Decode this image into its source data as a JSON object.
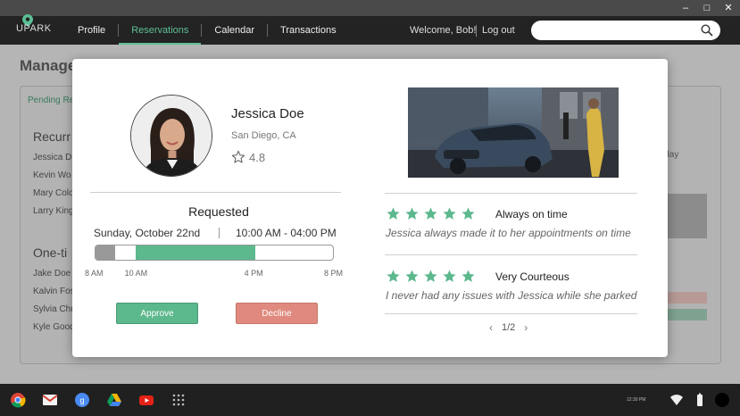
{
  "window": {
    "minimize": "–",
    "maximize": "□",
    "close": "✕"
  },
  "nav": {
    "logo": "UPARK",
    "tabs": [
      {
        "label": "Profile"
      },
      {
        "label": "Reservations"
      },
      {
        "label": "Calendar"
      },
      {
        "label": "Transactions"
      }
    ],
    "active_tab": "Reservations",
    "welcome": "Welcome, Bob!",
    "logout": "Log out",
    "search_placeholder": ""
  },
  "background_page": {
    "title": "Manage",
    "tab": "Pending Re",
    "section_recurring": "Recurr",
    "recurring_names": [
      "Jessica D",
      "Kevin Wo",
      "Mary Colo",
      "Larry King"
    ],
    "section_onetime": "One-ti",
    "onetime_names": [
      "Jake Doe",
      "Kalvin Fos",
      "Sylvia Chu",
      "Kyle Good"
    ],
    "day_label": "aturday"
  },
  "modal": {
    "profile": {
      "name": "Jessica Doe",
      "location": "San Diego, CA",
      "rating": "4.8"
    },
    "status": "Requested",
    "date": "Sunday, October 22nd",
    "time": "10:00 AM - 04:00 PM",
    "timeline": {
      "ticks": [
        "8 AM",
        "10 AM",
        "4 PM",
        "8 PM"
      ],
      "day_start_hour": 8,
      "day_end_hour": 20,
      "past_until_hour": 9,
      "reserved_start_hour": 10,
      "reserved_end_hour": 16
    },
    "approve_label": "Approve",
    "decline_label": "Decline",
    "reviews": [
      {
        "stars": 5,
        "title": "Always on time",
        "text": "Jessica always made it to her appointments on time"
      },
      {
        "stars": 5,
        "title": "Very Courteous",
        "text": "I never had any issues with Jessica while she parked"
      }
    ],
    "pager": "1/2"
  },
  "colors": {
    "accent": "#5cbf95",
    "approve": "#5cb88d",
    "decline": "#e08a7f",
    "bar_past": "#999999",
    "bar_reserved": "#5cb88d"
  },
  "taskbar": {
    "apps": [
      "chrome-icon",
      "gmail-icon",
      "google-plus-icon",
      "drive-icon",
      "youtube-icon",
      "apps-grid-icon"
    ],
    "clock": "12:30 PM"
  }
}
